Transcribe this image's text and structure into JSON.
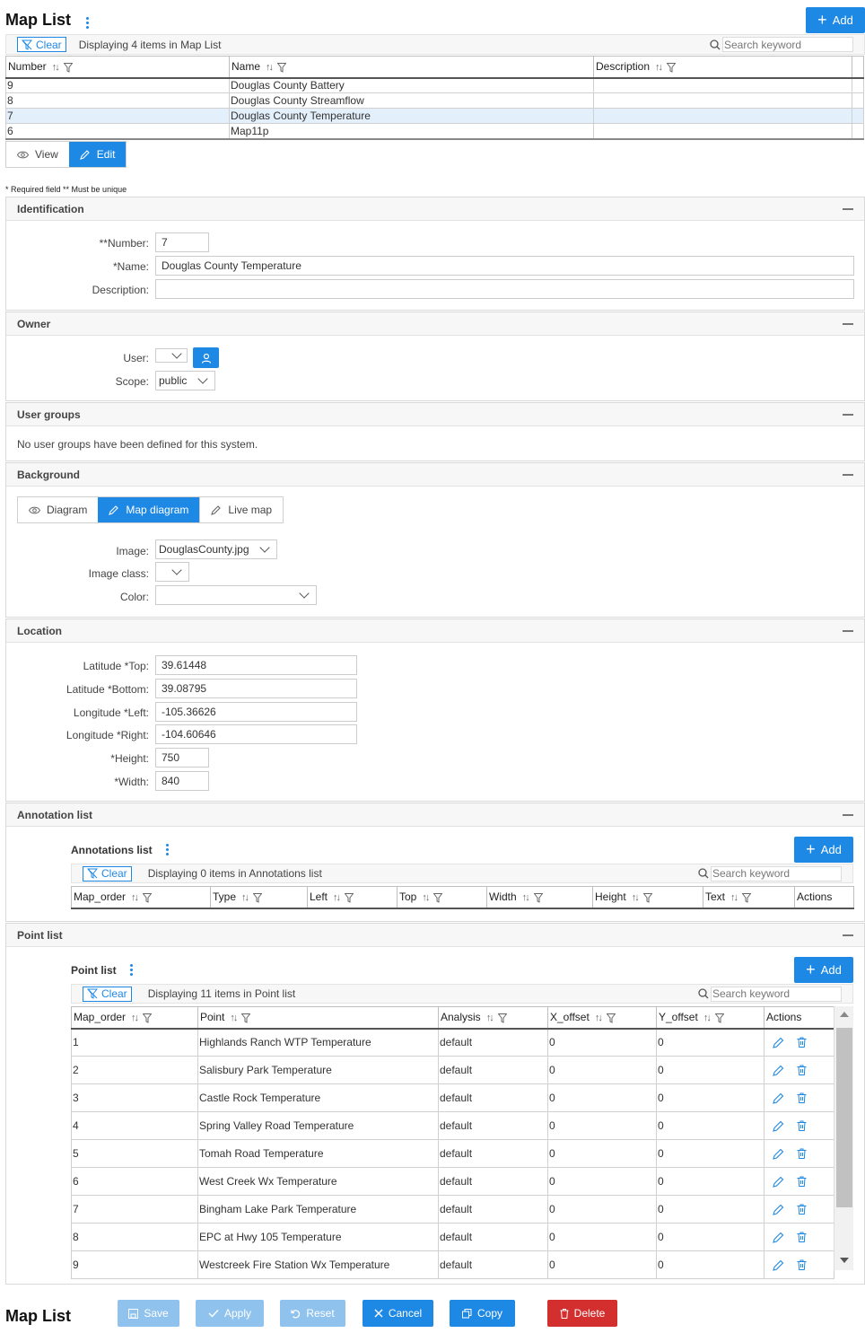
{
  "header": {
    "title": "Map List",
    "add_label": "Add"
  },
  "map_toolbar": {
    "clear_label": "Clear",
    "info": "Displaying 4 items in Map List",
    "search_placeholder": "Search keyword"
  },
  "map_table": {
    "columns": [
      "Number",
      "Name",
      "Description"
    ],
    "rows": [
      {
        "number": "9",
        "name": "Douglas County Battery",
        "description": ""
      },
      {
        "number": "8",
        "name": "Douglas County Streamflow",
        "description": ""
      },
      {
        "number": "7",
        "name": "Douglas County Temperature",
        "description": ""
      },
      {
        "number": "6",
        "name": "Map11p",
        "description": ""
      }
    ]
  },
  "mode_tabs": {
    "view": "View",
    "edit": "Edit"
  },
  "required_note": "* Required field ** Must be unique",
  "identification": {
    "title": "Identification",
    "number_label": "**Number:",
    "number_value": "7",
    "name_label": "*Name:",
    "name_value": "Douglas County Temperature",
    "description_label": "Description:",
    "description_value": ""
  },
  "owner": {
    "title": "Owner",
    "user_label": "User:",
    "user_value": "",
    "scope_label": "Scope:",
    "scope_value": "public"
  },
  "user_groups": {
    "title": "User groups",
    "message": "No user groups have been defined for this system."
  },
  "background": {
    "title": "Background",
    "tabs": {
      "diagram": "Diagram",
      "map_diagram": "Map diagram",
      "live_map": "Live map"
    },
    "image_label": "Image:",
    "image_value": "DouglasCounty.jpg",
    "image_class_label": "Image class:",
    "image_class_value": "",
    "color_label": "Color:",
    "color_value": ""
  },
  "location": {
    "title": "Location",
    "lat_top_label": "Latitude *Top:",
    "lat_top_value": "39.61448",
    "lat_bottom_label": "Latitude *Bottom:",
    "lat_bottom_value": "39.08795",
    "lon_left_label": "Longitude *Left:",
    "lon_left_value": "-105.36626",
    "lon_right_label": "Longitude *Right:",
    "lon_right_value": "-104.60646",
    "height_label": "*Height:",
    "height_value": "750",
    "width_label": "*Width:",
    "width_value": "840"
  },
  "annotation_list": {
    "title": "Annotation list",
    "subtitle": "Annotations list",
    "add_label": "Add",
    "clear_label": "Clear",
    "info": "Displaying 0 items in Annotations list",
    "search_placeholder": "Search keyword",
    "columns": [
      "Map_order",
      "Type",
      "Left",
      "Top",
      "Width",
      "Height",
      "Text",
      "Actions"
    ]
  },
  "point_list": {
    "title": "Point list",
    "subtitle": "Point list",
    "add_label": "Add",
    "clear_label": "Clear",
    "info": "Displaying 11 items in Point list",
    "search_placeholder": "Search keyword",
    "columns": [
      "Map_order",
      "Point",
      "Analysis",
      "X_offset",
      "Y_offset",
      "Actions"
    ],
    "rows": [
      {
        "order": "1",
        "point": "Highlands Ranch WTP Temperature",
        "analysis": "default",
        "x": "0",
        "y": "0"
      },
      {
        "order": "2",
        "point": "Salisbury Park Temperature",
        "analysis": "default",
        "x": "0",
        "y": "0"
      },
      {
        "order": "3",
        "point": "Castle Rock Temperature",
        "analysis": "default",
        "x": "0",
        "y": "0"
      },
      {
        "order": "4",
        "point": "Spring Valley Road Temperature",
        "analysis": "default",
        "x": "0",
        "y": "0"
      },
      {
        "order": "5",
        "point": "Tomah Road Temperature",
        "analysis": "default",
        "x": "0",
        "y": "0"
      },
      {
        "order": "6",
        "point": "West Creek Wx Temperature",
        "analysis": "default",
        "x": "0",
        "y": "0"
      },
      {
        "order": "7",
        "point": "Bingham Lake Park Temperature",
        "analysis": "default",
        "x": "0",
        "y": "0"
      },
      {
        "order": "8",
        "point": "EPC at Hwy 105 Temperature",
        "analysis": "default",
        "x": "0",
        "y": "0"
      },
      {
        "order": "9",
        "point": "Westcreek Fire Station Wx Temperature",
        "analysis": "default",
        "x": "0",
        "y": "0"
      }
    ]
  },
  "footer": {
    "title": "Map List",
    "save": "Save",
    "apply": "Apply",
    "reset": "Reset",
    "cancel": "Cancel",
    "copy": "Copy",
    "delete": "Delete"
  },
  "colors": {
    "primary": "#1e88e5",
    "disabled": "#8fc3ee",
    "danger": "#d32f2f",
    "selected_row": "#e3effb"
  }
}
